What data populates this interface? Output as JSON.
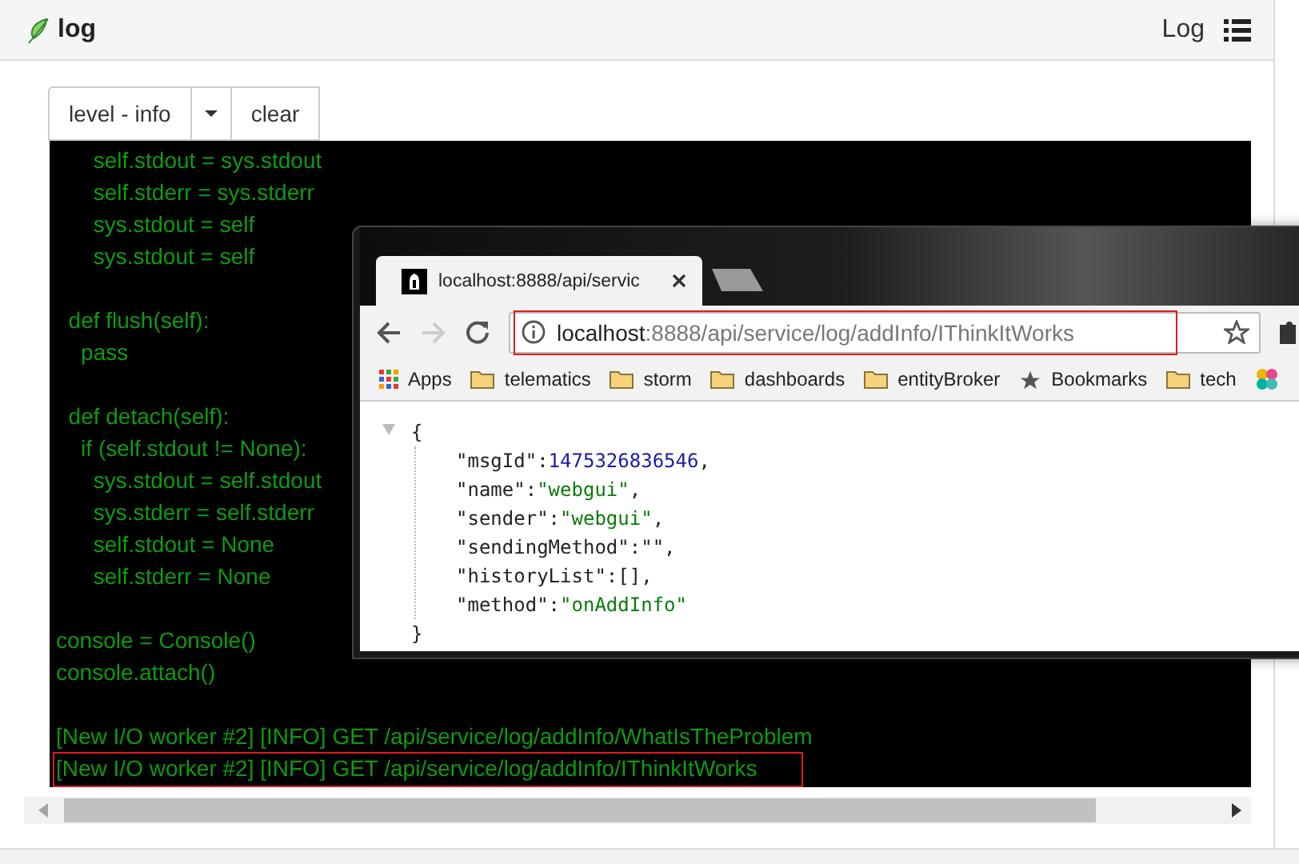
{
  "header": {
    "title": "log",
    "nav_label": "Log"
  },
  "toolbar": {
    "level_button": "level - info",
    "clear_button": "clear"
  },
  "console": {
    "lines": [
      {
        "kind": "code",
        "text": "      self.stdout = sys.stdout",
        "highlighted": false
      },
      {
        "kind": "code",
        "text": "      self.stderr = sys.stderr",
        "highlighted": false
      },
      {
        "kind": "code",
        "text": "      sys.stdout = self",
        "highlighted": false
      },
      {
        "kind": "code",
        "text": "      sys.stdout = self",
        "highlighted": false
      },
      {
        "kind": "blank"
      },
      {
        "kind": "code",
        "text": "  def flush(self):",
        "highlighted": false
      },
      {
        "kind": "code",
        "text": "    pass",
        "highlighted": false
      },
      {
        "kind": "blank"
      },
      {
        "kind": "code",
        "text": "  def detach(self):",
        "highlighted": false
      },
      {
        "kind": "code",
        "text": "    if (self.stdout != None):",
        "highlighted": false
      },
      {
        "kind": "code",
        "text": "      sys.stdout = self.stdout",
        "highlighted": false
      },
      {
        "kind": "code",
        "text": "      sys.stderr = self.stderr",
        "highlighted": false
      },
      {
        "kind": "code",
        "text": "      self.stdout = None",
        "highlighted": false
      },
      {
        "kind": "code",
        "text": "      self.stderr = None",
        "highlighted": false
      },
      {
        "kind": "blank"
      },
      {
        "kind": "code",
        "text": "console = Console()",
        "highlighted": false
      },
      {
        "kind": "code",
        "text": "console.attach()",
        "highlighted": false
      },
      {
        "kind": "blank"
      },
      {
        "kind": "code",
        "text": "[New I/O worker #2] [INFO] GET /api/service/log/addInfo/WhatIsTheProblem",
        "highlighted": false
      },
      {
        "kind": "code",
        "text": "[New I/O worker #2] [INFO] GET /api/service/log/addInfo/IThinkItWorks",
        "highlighted": true
      }
    ]
  },
  "browser": {
    "tab_title": "localhost:8888/api/servic",
    "url_host": "localhost",
    "url_path": ":8888/api/service/log/addInfo/IThinkItWorks",
    "url_highlighted": true,
    "bookmarks": [
      {
        "kind": "apps",
        "label": "Apps"
      },
      {
        "kind": "folder",
        "label": "telematics"
      },
      {
        "kind": "folder",
        "label": "storm"
      },
      {
        "kind": "folder",
        "label": "dashboards"
      },
      {
        "kind": "folder",
        "label": "entityBroker"
      },
      {
        "kind": "star",
        "label": "Bookmarks"
      },
      {
        "kind": "folder",
        "label": "tech"
      },
      {
        "kind": "logo"
      }
    ],
    "json_open": "{",
    "json_close": "}",
    "json_lines": [
      {
        "key": "\"msgId\":",
        "value": "1475326836546",
        "kind": "number",
        "punct": ","
      },
      {
        "key": "\"name\":",
        "value": "\"webgui\"",
        "kind": "string",
        "punct": ","
      },
      {
        "key": "\"sender\":",
        "value": "\"webgui\"",
        "kind": "string",
        "punct": ","
      },
      {
        "key": "\"sendingMethod\":",
        "value": "\"\"",
        "kind": "other",
        "punct": ","
      },
      {
        "key": "\"historyList\":",
        "value": "[]",
        "kind": "other",
        "punct": ","
      },
      {
        "key": "\"method\":",
        "value": "\"onAddInfo\"",
        "kind": "string"
      }
    ]
  }
}
